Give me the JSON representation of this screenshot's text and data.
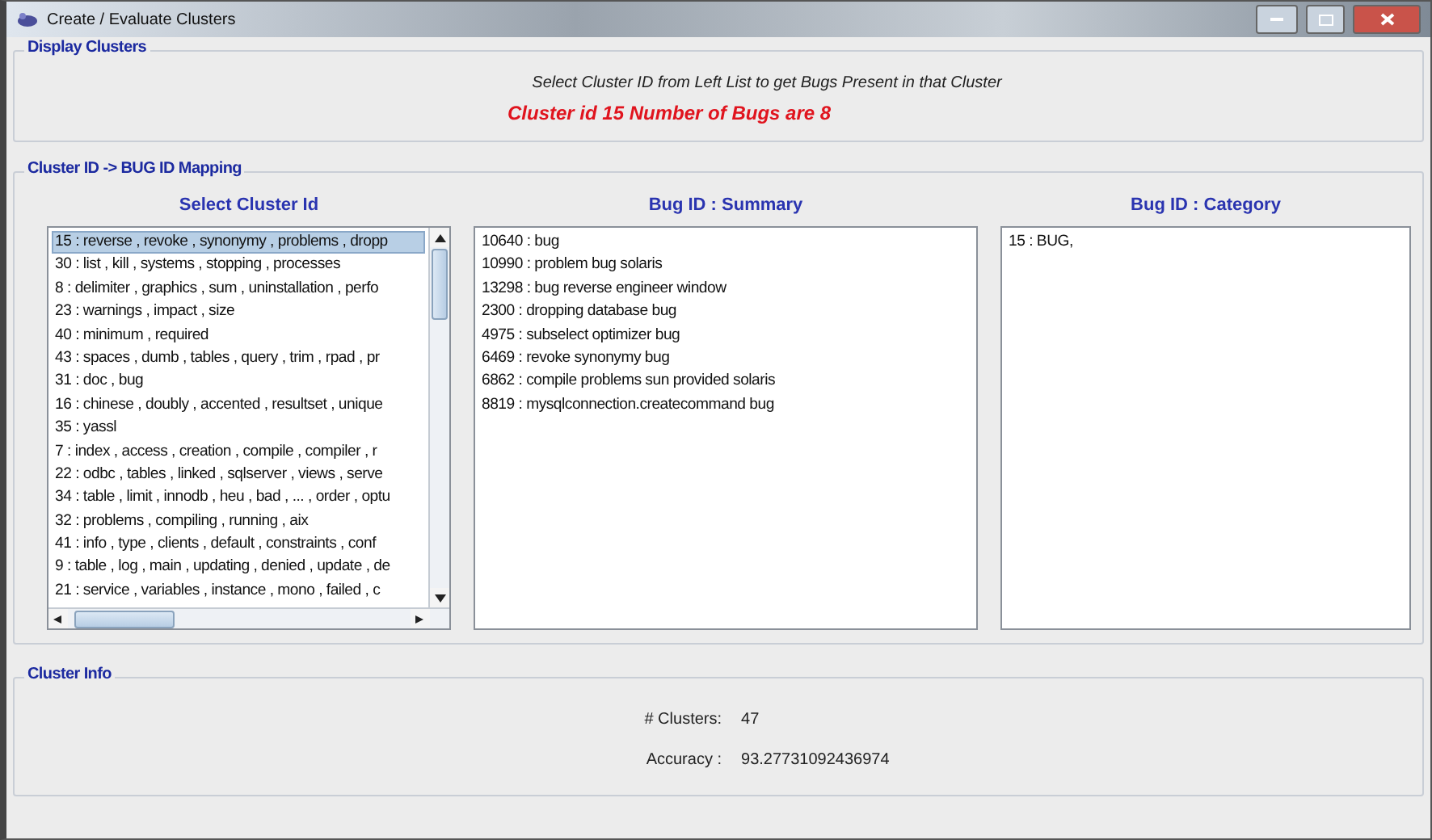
{
  "window": {
    "title": "Create / Evaluate Clusters"
  },
  "display_clusters": {
    "title": "Display Clusters",
    "instruction": "Select Cluster ID from Left List to get Bugs Present in that Cluster",
    "result": "Cluster id 15 Number of Bugs are 8"
  },
  "mapping": {
    "title": "Cluster ID -> BUG ID Mapping",
    "cluster_list": {
      "heading": "Select Cluster Id",
      "items": [
        {
          "label": "15 : reverse , revoke , synonymy , problems , dropp",
          "selected": true
        },
        {
          "label": "30 : list , kill , systems , stopping , processes",
          "selected": false
        },
        {
          "label": "8 : delimiter , graphics , sum , uninstallation , perfo",
          "selected": false
        },
        {
          "label": "23 : warnings , impact , size",
          "selected": false
        },
        {
          "label": "40 : minimum , required",
          "selected": false
        },
        {
          "label": "43 : spaces , dumb , tables , query , trim , rpad , pr",
          "selected": false
        },
        {
          "label": "31 : doc , bug",
          "selected": false
        },
        {
          "label": "16 : chinese , doubly , accented , resultset , unique",
          "selected": false
        },
        {
          "label": "35 : yassl",
          "selected": false
        },
        {
          "label": "7 : index , access , creation , compile , compiler , r",
          "selected": false
        },
        {
          "label": "22 : odbc , tables , linked , sqlserver , views , serve",
          "selected": false
        },
        {
          "label": "34 : table , limit , innodb , heu , bad , ... , order , optu",
          "selected": false
        },
        {
          "label": "32 : problems , compiling , running , aix",
          "selected": false
        },
        {
          "label": "41 : info , type , clients , default , constraints , conf",
          "selected": false
        },
        {
          "label": "9 : table , log , main , updating , denied , update , de",
          "selected": false
        },
        {
          "label": "21 : service , variables , instance , mono , failed , c",
          "selected": false
        }
      ]
    },
    "summary_list": {
      "heading": "Bug ID : Summary",
      "items": [
        "10640 : bug",
        "10990 : problem bug solaris",
        "13298 : bug reverse engineer window",
        "2300 : dropping database bug",
        "4975 : subselect optimizer bug",
        "6469 : revoke synonymy bug",
        "6862 : compile problems sun provided solaris",
        "8819 :  mysqlconnection.createcommand bug"
      ]
    },
    "category_list": {
      "heading": "Bug ID : Category",
      "items": [
        "15 : BUG,"
      ]
    }
  },
  "cluster_info": {
    "title": "Cluster Info",
    "fields": [
      {
        "label": "# Clusters:",
        "value": "47"
      },
      {
        "label": "Accuracy :",
        "value": "93.27731092436974"
      }
    ]
  }
}
